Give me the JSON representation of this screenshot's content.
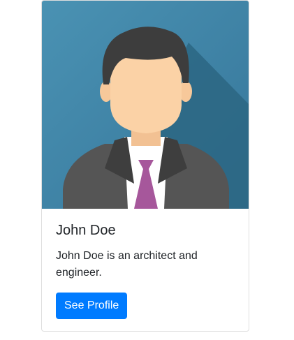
{
  "card": {
    "image_icon": "user-avatar-illustration",
    "title": "John Doe",
    "text": "John Doe is an architect and engineer.",
    "button_label": "See Profile"
  },
  "colors": {
    "image_background": "#3f86a6",
    "shadow": "#2b6480",
    "suit": "#4a4a4a",
    "hair": "#3b3b3b",
    "skin": "#f9cfa3",
    "tie": "#a6579b",
    "button": "#007bff"
  }
}
